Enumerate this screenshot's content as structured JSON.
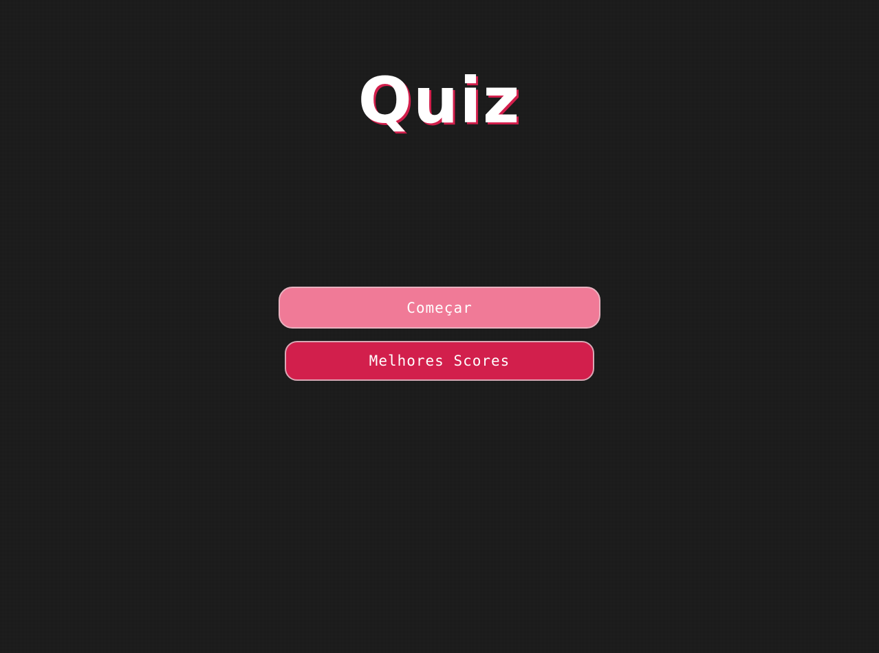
{
  "app": {
    "title": "Quiz"
  },
  "menu": {
    "start_label": "Começar",
    "scores_label": "Melhores Scores"
  },
  "colors": {
    "background": "#1b1b1b",
    "accent": "#d21f4c",
    "start_button": "#f07a97",
    "title_text": "#ffffff"
  }
}
